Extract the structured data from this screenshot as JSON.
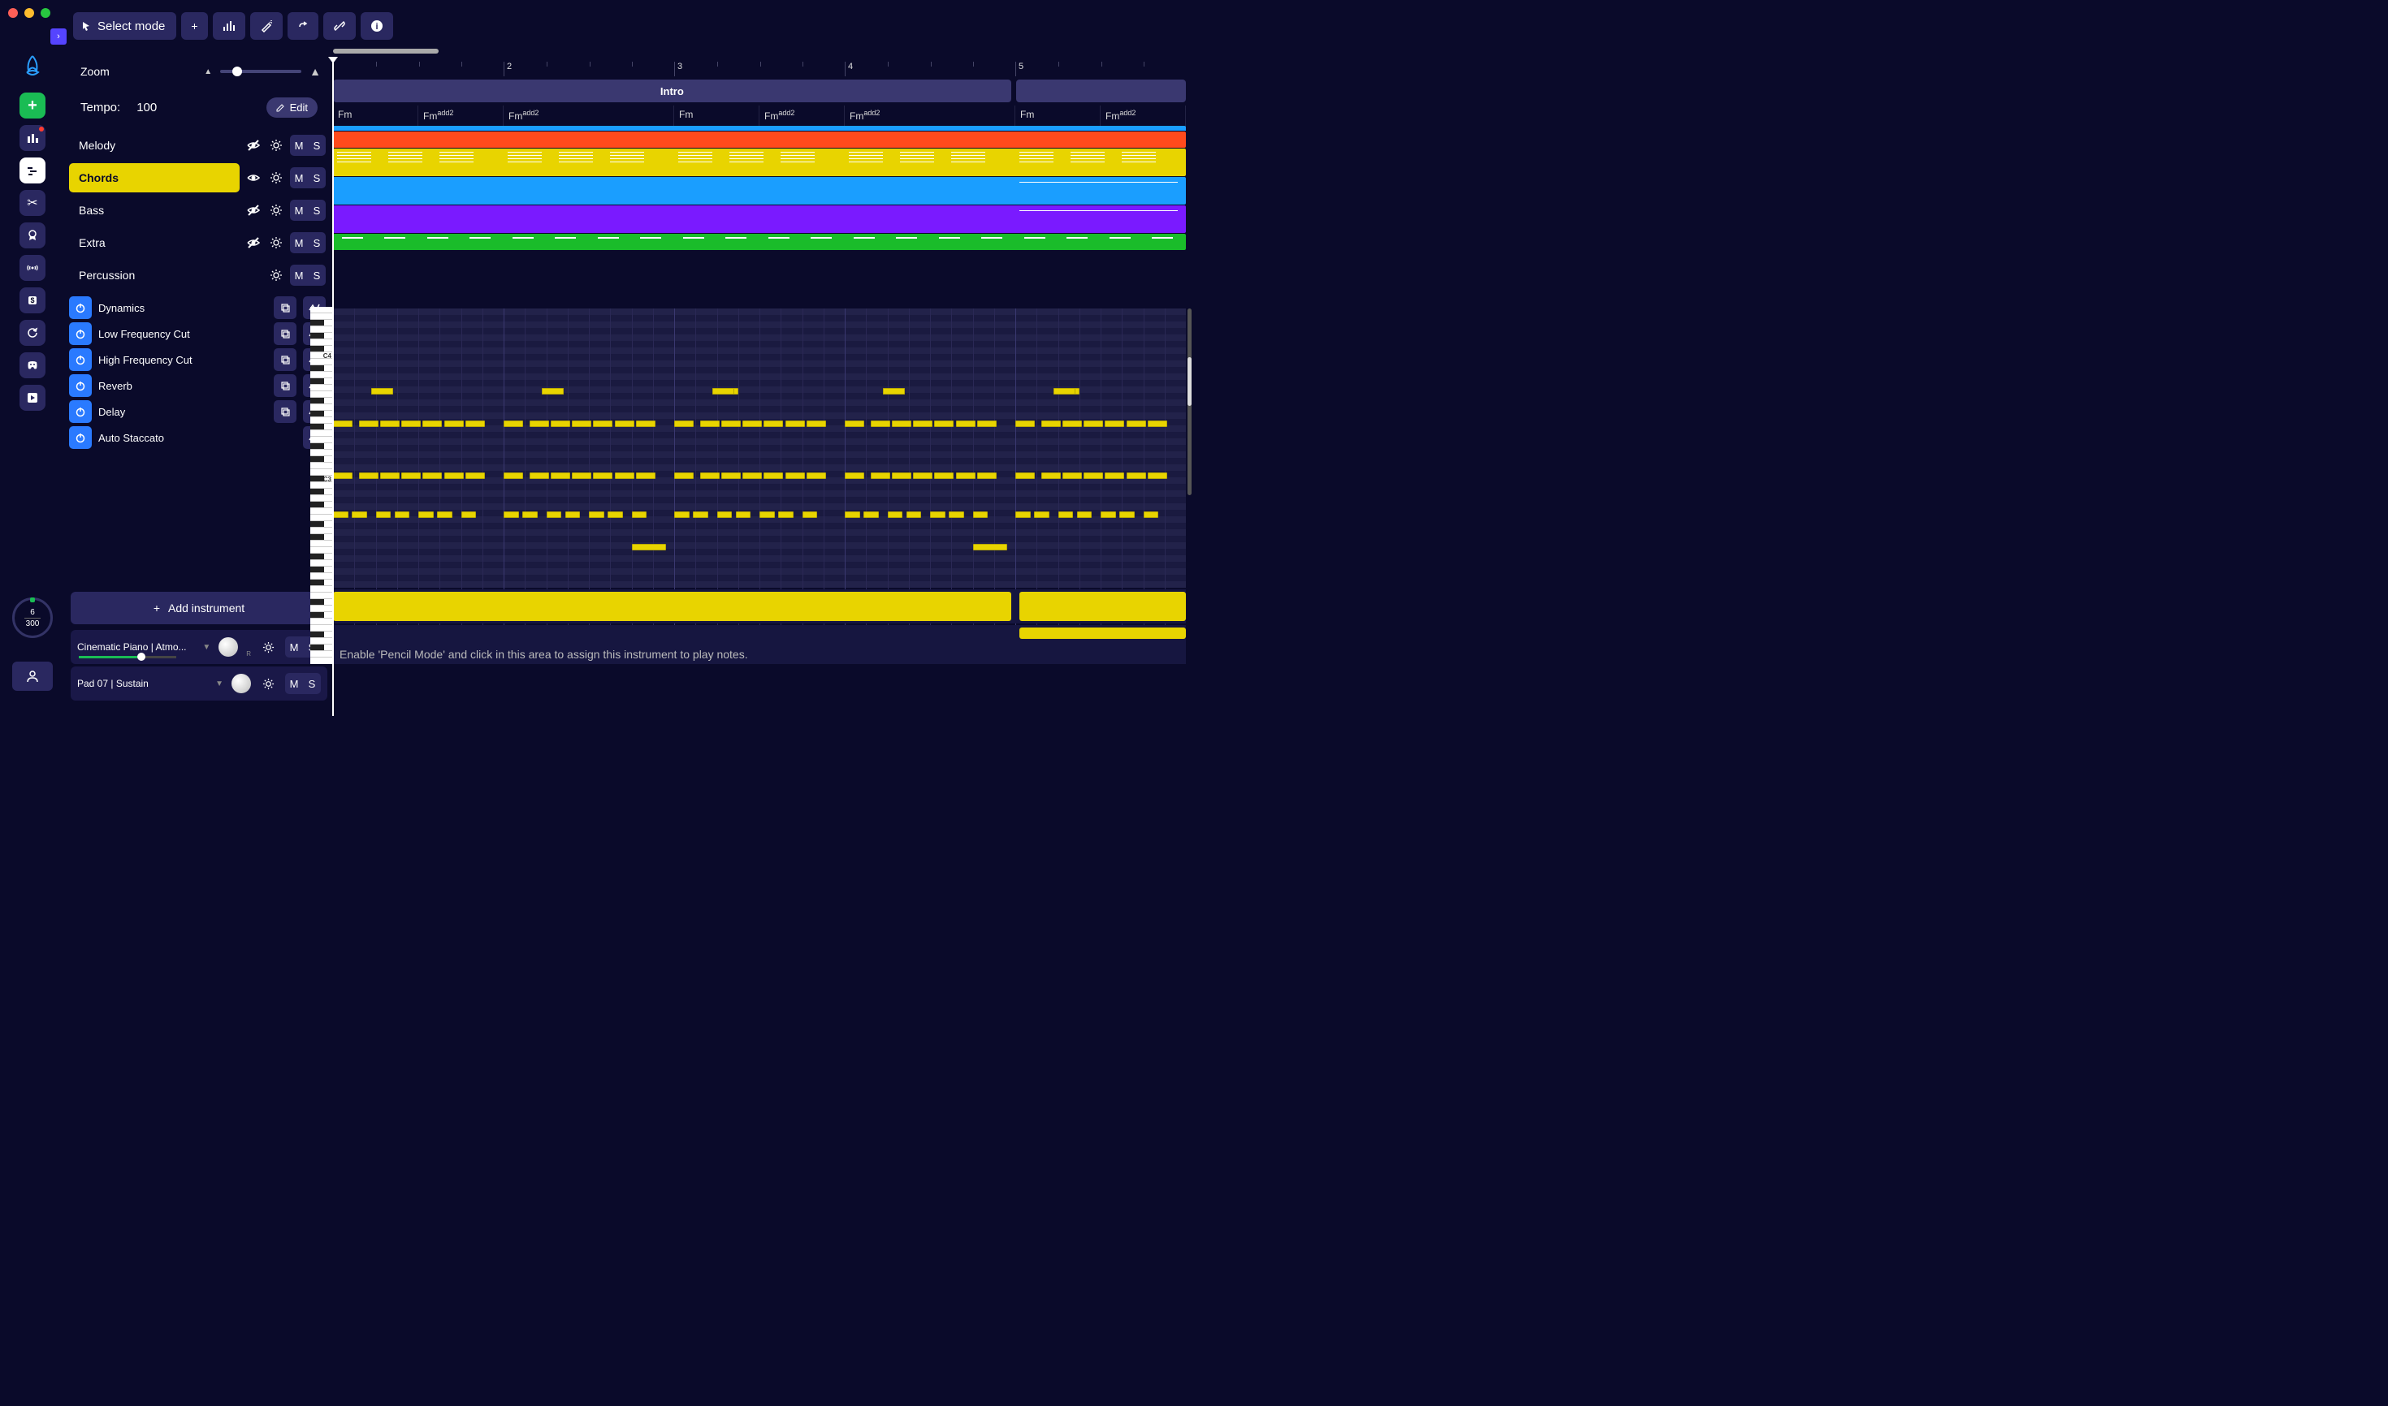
{
  "toolbar": {
    "select_mode_label": "Select mode"
  },
  "side": {
    "zoom_label": "Zoom",
    "tempo_label": "Tempo:",
    "tempo_value": "100",
    "edit_label": "Edit",
    "add_instrument_label": "Add instrument"
  },
  "tracks": [
    {
      "name": "Melody",
      "selected": false,
      "hidden": true
    },
    {
      "name": "Chords",
      "selected": true,
      "hidden": false
    },
    {
      "name": "Bass",
      "selected": false,
      "hidden": true
    },
    {
      "name": "Extra",
      "selected": false,
      "hidden": true
    },
    {
      "name": "Percussion",
      "selected": false,
      "hidden": false,
      "no_eye": true
    }
  ],
  "fx": [
    {
      "name": "Dynamics",
      "copy": true
    },
    {
      "name": "Low Frequency Cut",
      "copy": true
    },
    {
      "name": "High Frequency Cut",
      "copy": true
    },
    {
      "name": "Reverb",
      "copy": true
    },
    {
      "name": "Delay",
      "copy": true
    },
    {
      "name": "Auto Staccato",
      "copy": false
    }
  ],
  "instruments": [
    {
      "name": "Cinematic Piano | Atmo...",
      "pan": "R"
    },
    {
      "name": "Pad 07 | Sustain",
      "pan": ""
    }
  ],
  "progress": {
    "current": "6",
    "total": "300"
  },
  "timeline": {
    "bars": [
      "",
      "2",
      "3",
      "4",
      "5"
    ],
    "section_label": "Intro",
    "chords": [
      "Fm",
      "Fm<sup>add2</sup>",
      "Fm<sup>add2</sup>",
      "Fm",
      "Fm<sup>add2</sup>",
      "Fm<sup>add2</sup>",
      "Fm",
      "Fm<sup>add2</sup>"
    ],
    "chord_widths": [
      10,
      10,
      20,
      10,
      10,
      20,
      10,
      10
    ]
  },
  "piano": {
    "c4_label": "C4",
    "c3_label": "C3"
  },
  "hint": "Enable 'Pencil Mode' and click in this area to assign this instrument to play notes."
}
